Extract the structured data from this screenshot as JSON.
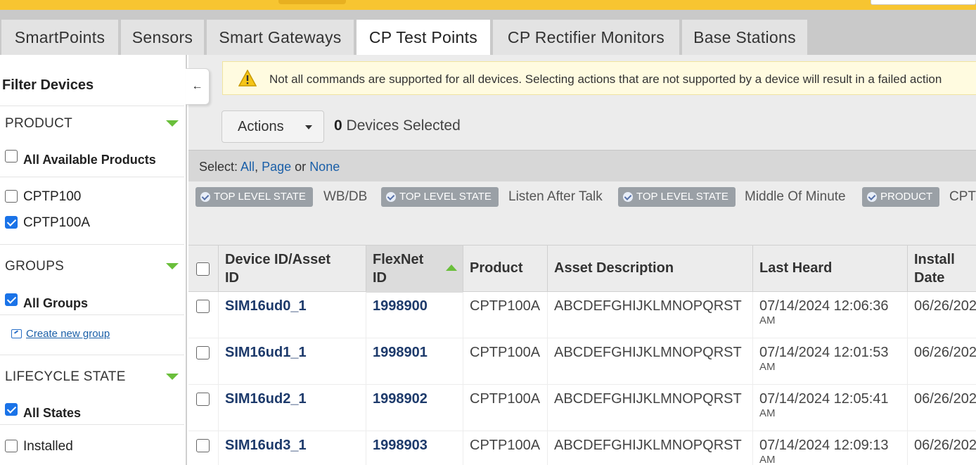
{
  "tabs": [
    "SmartPoints",
    "Sensors",
    "Smart Gateways",
    "CP Test Points",
    "CP Rectifier Monitors",
    "Base Stations"
  ],
  "active_tab": "CP Test Points",
  "sidebar": {
    "title": "Filter Devices",
    "collapse_icon": "←",
    "product": {
      "label": "PRODUCT",
      "all_label": "All Available Products",
      "all_checked": false,
      "items": [
        {
          "label": "CPTP100",
          "checked": false
        },
        {
          "label": "CPTP100A",
          "checked": true
        }
      ]
    },
    "groups": {
      "label": "GROUPS",
      "all_label": "All Groups",
      "all_checked": true,
      "create_link": "Create new group"
    },
    "lifecycle": {
      "label": "LIFECYCLE STATE",
      "all_label": "All States",
      "all_checked": true,
      "items": [
        {
          "label": "Installed",
          "checked": false
        }
      ]
    }
  },
  "warning": {
    "icon": "warning-icon",
    "text": "Not all commands are supported for all devices. Selecting actions that are not supported by a device will result in a failed action"
  },
  "actions_label": "Actions",
  "selected_count": "0",
  "selected_suffix": "Devices Selected",
  "select_bar": {
    "prefix": "Select:",
    "all": "All",
    "page": "Page",
    "or": "or",
    "none": "None"
  },
  "filters": [
    {
      "tag": "TOP LEVEL STATE",
      "value": "WB/DB"
    },
    {
      "tag": "TOP LEVEL STATE",
      "value": "Listen After Talk"
    },
    {
      "tag": "TOP LEVEL STATE",
      "value": "Middle Of Minute"
    },
    {
      "tag": "PRODUCT",
      "value": "CPT"
    }
  ],
  "table": {
    "columns": [
      {
        "line1": "Device ID/Asset",
        "line2": "ID"
      },
      {
        "line1": "FlexNet",
        "line2": "ID",
        "sorted": "asc"
      },
      {
        "line1": "Product",
        "line2": ""
      },
      {
        "line1": "Asset Description",
        "line2": ""
      },
      {
        "line1": "Last Heard",
        "line2": ""
      },
      {
        "line1": "Install",
        "line2": "Date"
      }
    ],
    "rows": [
      {
        "device_id": "SIM16ud0_1",
        "flexnet_id": "1998900",
        "product": "CPTP100A",
        "asset_description": "ABCDEFGHIJKLMNOPQRST",
        "last_heard": "07/14/2024 12:06:36",
        "last_heard_ampm": "AM",
        "install_date": "06/26/202"
      },
      {
        "device_id": "SIM16ud1_1",
        "flexnet_id": "1998901",
        "product": "CPTP100A",
        "asset_description": "ABCDEFGHIJKLMNOPQRST",
        "last_heard": "07/14/2024 12:01:53",
        "last_heard_ampm": "AM",
        "install_date": "06/26/202"
      },
      {
        "device_id": "SIM16ud2_1",
        "flexnet_id": "1998902",
        "product": "CPTP100A",
        "asset_description": "ABCDEFGHIJKLMNOPQRST",
        "last_heard": "07/14/2024 12:05:41",
        "last_heard_ampm": "AM",
        "install_date": "06/26/202"
      },
      {
        "device_id": "SIM16ud3_1",
        "flexnet_id": "1998903",
        "product": "CPTP100A",
        "asset_description": "ABCDEFGHIJKLMNOPQRST",
        "last_heard": "07/14/2024 12:09:13",
        "last_heard_ampm": "AM",
        "install_date": "06/26/202"
      }
    ]
  },
  "colors": {
    "brand_yellow": "#f7c531",
    "accent_green": "#6abf3b",
    "link_blue": "#1a5fa8",
    "chip_gray": "#9aa0a6"
  }
}
